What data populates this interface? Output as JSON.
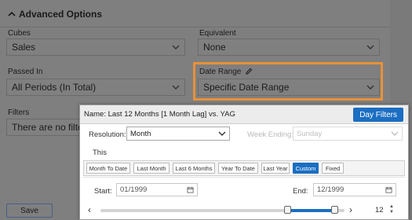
{
  "advanced": {
    "title": "Advanced Options",
    "cubes_label": "Cubes",
    "cubes_value": "Sales",
    "equivalent_label": "Equivalent",
    "equivalent_value": "None",
    "passed_in_label": "Passed In",
    "passed_in_value": "All Periods (In Total)",
    "date_range_label": "Date Range",
    "date_range_value": "Specific Date Range",
    "filters_label": "Filters",
    "filters_value": "There are no filter",
    "save_label": "Save"
  },
  "popup": {
    "title": "Name: Last 12 Months [1 Month Lag] vs. YAG",
    "day_filters_label": "Day Filters",
    "resolution_label": "Resolution:",
    "resolution_value": "Month",
    "week_ending_label": "Week Ending:",
    "week_ending_value": "Sunday",
    "this_label": "This",
    "buttons": [
      {
        "label": "Month To Date",
        "active": false
      },
      {
        "label": "Last Month",
        "active": false
      },
      {
        "label": "Last 6 Months",
        "active": false
      },
      {
        "label": "Year To Date",
        "active": false
      },
      {
        "label": "Last Year",
        "active": false
      },
      {
        "label": "Custom",
        "active": true
      },
      {
        "label": "Fixed",
        "active": false
      }
    ],
    "start_label": "Start:",
    "start_value": "01/1999",
    "end_label": "End:",
    "end_value": "12/1999",
    "period_count": "12"
  },
  "colors": {
    "accent": "#1b6ec2",
    "highlight": "#e8913a"
  }
}
